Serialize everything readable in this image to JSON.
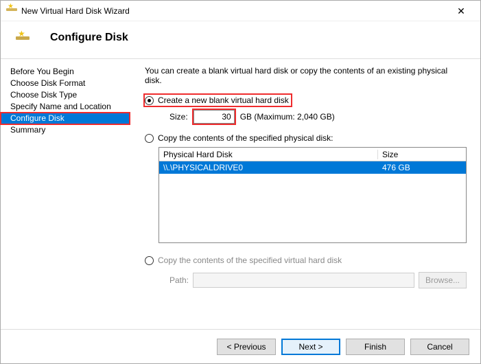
{
  "window": {
    "title": "New Virtual Hard Disk Wizard"
  },
  "header": {
    "title": "Configure Disk"
  },
  "sidebar": {
    "items": [
      {
        "label": "Before You Begin"
      },
      {
        "label": "Choose Disk Format"
      },
      {
        "label": "Choose Disk Type"
      },
      {
        "label": "Specify Name and Location"
      },
      {
        "label": "Configure Disk"
      },
      {
        "label": "Summary"
      }
    ],
    "activeIndex": 4
  },
  "content": {
    "desc": "You can create a blank virtual hard disk or copy the contents of an existing physical disk.",
    "opt_blank": "Create a new blank virtual hard disk",
    "size_label": "Size:",
    "size_value": "30",
    "size_suffix": "GB (Maximum: 2,040 GB)",
    "opt_copy_physical": "Copy the contents of the specified physical disk:",
    "table": {
      "col1": "Physical Hard Disk",
      "col2": "Size",
      "row1_col1": "\\\\.\\PHYSICALDRIVE0",
      "row1_col2": "476 GB"
    },
    "opt_copy_virtual": "Copy the contents of the specified virtual hard disk",
    "path_label": "Path:",
    "browse": "Browse..."
  },
  "footer": {
    "previous": "< Previous",
    "next": "Next >",
    "finish": "Finish",
    "cancel": "Cancel"
  }
}
